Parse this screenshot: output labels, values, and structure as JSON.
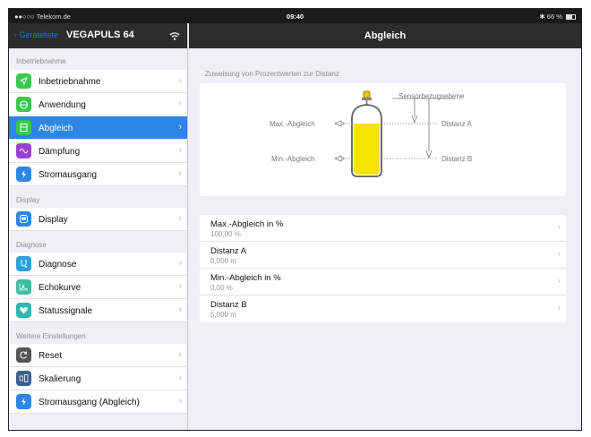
{
  "status_bar": {
    "carrier": "●●○○○ Telekom.de",
    "time": "09:40",
    "battery": "66 %"
  },
  "sidebar": {
    "back_label": "Geräteliste",
    "title": "VEGAPULS 64",
    "sections": [
      {
        "header": "Inbetriebnahme",
        "items": [
          {
            "label": "Inbetriebnahme",
            "icon": "check-icon",
            "color": "#3bc94d"
          },
          {
            "label": "Anwendung",
            "icon": "tank-icon",
            "color": "#3bc94d"
          },
          {
            "label": "Abgleich",
            "icon": "adjustment-icon",
            "color": "#3bc94d",
            "active": true
          },
          {
            "label": "Dämpfung",
            "icon": "wave-icon",
            "color": "#9b3fd1"
          },
          {
            "label": "Stromausgang",
            "icon": "lightning-icon",
            "color": "#2d86e6"
          }
        ]
      },
      {
        "header": "Display",
        "items": [
          {
            "label": "Display",
            "icon": "display-icon",
            "color": "#2d86e6"
          }
        ]
      },
      {
        "header": "Diagnose",
        "items": [
          {
            "label": "Diagnose",
            "icon": "stethoscope-icon",
            "color": "#2fa1d6"
          },
          {
            "label": "Echokurve",
            "icon": "echo-curve-icon",
            "color": "#3bbf9f"
          },
          {
            "label": "Statussignale",
            "icon": "heart-icon",
            "color": "#2fb8b0"
          }
        ]
      },
      {
        "header": "Weitere Einstellungen",
        "items": [
          {
            "label": "Reset",
            "icon": "reset-icon",
            "color": "#555555"
          },
          {
            "label": "Skalierung",
            "icon": "scaling-icon",
            "color": "#3a5f8a"
          },
          {
            "label": "Stromausgang (Abgleich)",
            "icon": "lightning-icon",
            "color": "#2d86e6"
          }
        ]
      }
    ]
  },
  "detail": {
    "title": "Abgleich",
    "assignment_title": "Zuweisung von Prozentwerten zur Distanz",
    "diagram": {
      "sensor_label": "Sensorbezugsebene",
      "max_label": "Max.-Abgleich",
      "min_label": "Min.-Abgleich",
      "distance_a_label": "Distanz A",
      "distance_b_label": "Distanz B",
      "fill_color": "#f4e400"
    },
    "rows": [
      {
        "name": "Max.-Abgleich in %",
        "value": "100,00 %"
      },
      {
        "name": "Distanz A",
        "value": "0,000 m"
      },
      {
        "name": "Min.-Abgleich in %",
        "value": "0,00 %"
      },
      {
        "name": "Distanz B",
        "value": "5,000 m"
      }
    ]
  },
  "colors": {
    "accent": "#2d86e6",
    "nav_bar": "#2c2c2c",
    "background": "#efeff4"
  }
}
